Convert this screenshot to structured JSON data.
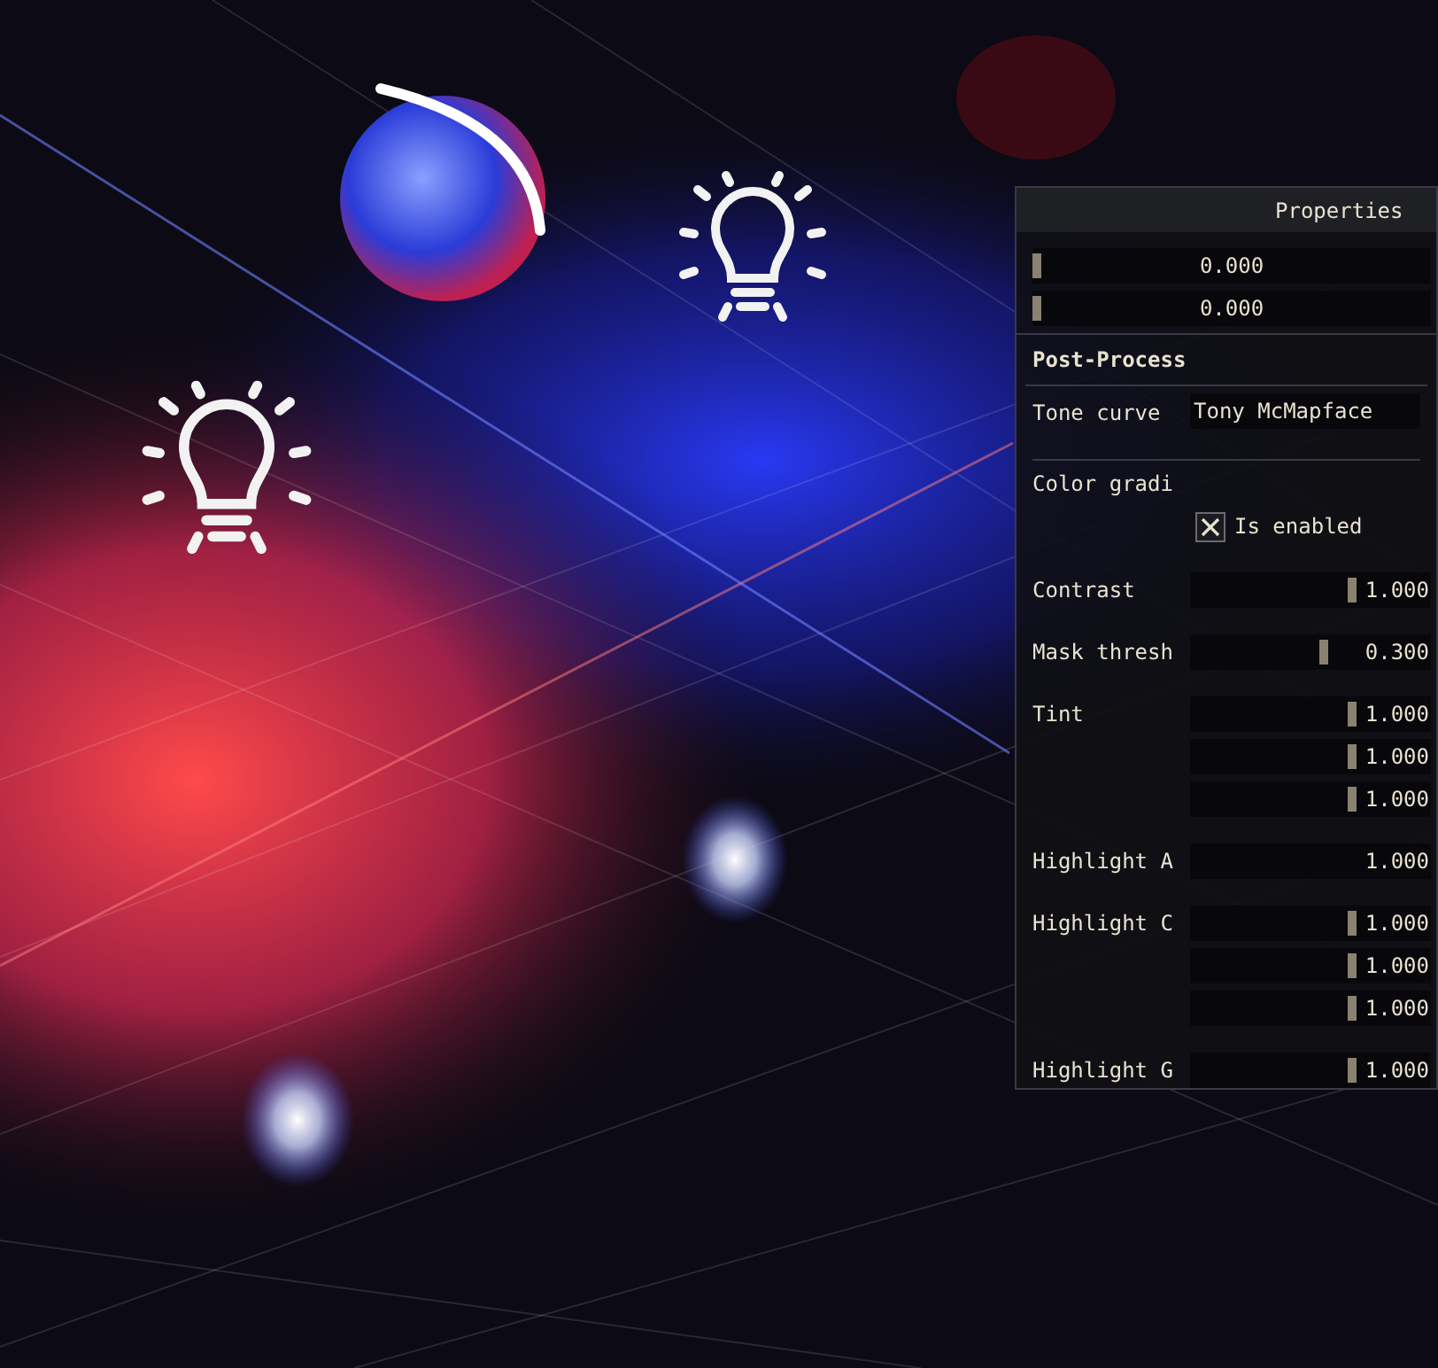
{
  "panel": {
    "title": "Properties",
    "top_sliders": [
      {
        "value": "0.000",
        "level": 0
      },
      {
        "value": "0.000",
        "level": 0
      }
    ],
    "section": "Post-Process",
    "tone_curve": {
      "label": "Tone curve",
      "value": "Tony McMapface"
    },
    "color_grading": {
      "label": "Color gradi",
      "checkbox": {
        "label": "Is enabled",
        "checked": true
      }
    },
    "params": [
      {
        "label": "Contrast",
        "sliders": [
          {
            "kind": "slider",
            "value": "1.000",
            "level": 0.68
          }
        ]
      },
      {
        "label": "Mask thresh",
        "sliders": [
          {
            "kind": "slider",
            "value": "0.300",
            "level": 0.56
          }
        ]
      },
      {
        "label": "Tint",
        "sliders": [
          {
            "kind": "slider",
            "value": "1.000",
            "level": 0.68
          },
          {
            "kind": "slider",
            "value": "1.000",
            "level": 0.68
          },
          {
            "kind": "slider",
            "value": "1.000",
            "level": 0.68
          }
        ]
      },
      {
        "label": "Highlight A",
        "sliders": [
          {
            "kind": "field",
            "value": "1.000"
          }
        ]
      },
      {
        "label": "Highlight C",
        "sliders": [
          {
            "kind": "slider",
            "value": "1.000",
            "level": 0.68
          },
          {
            "kind": "slider",
            "value": "1.000",
            "level": 0.68
          },
          {
            "kind": "slider",
            "value": "1.000",
            "level": 0.68
          }
        ]
      },
      {
        "label": "Highlight G",
        "sliders": [
          {
            "kind": "slider",
            "value": "1.000",
            "level": 0.68
          }
        ]
      }
    ]
  }
}
